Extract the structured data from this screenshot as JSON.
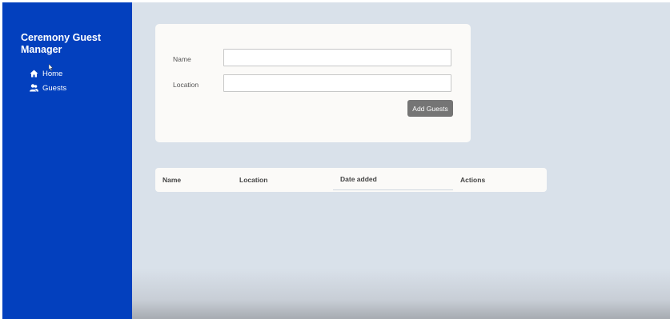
{
  "sidebar": {
    "brand": "Ceremony Guest Manager",
    "nav": [
      {
        "label": "Home",
        "icon": "home-icon"
      },
      {
        "label": "Guests",
        "icon": "users-icon"
      }
    ]
  },
  "form": {
    "name_label": "Name",
    "name_value": "",
    "location_label": "Location",
    "location_value": "",
    "submit_label": "Add Guests"
  },
  "table": {
    "columns": [
      "Name",
      "Location",
      "Date added",
      "Actions"
    ],
    "rows": []
  },
  "colors": {
    "sidebar": "#0340be",
    "background": "#d9e1ea",
    "card": "#fbfaf8",
    "button": "#757575"
  }
}
